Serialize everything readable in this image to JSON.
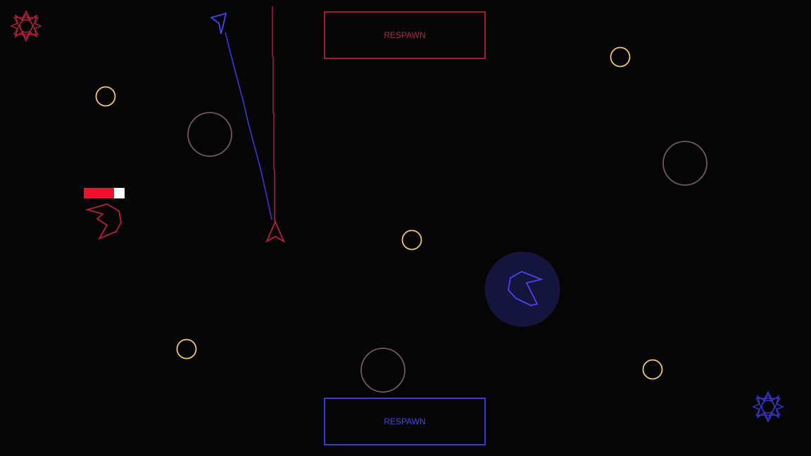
{
  "colors": {
    "background": "#050505",
    "red_team": "#a01e3c",
    "blue_team": "#3c36d2",
    "coin": "#f0c878",
    "asteroid": "#6e5a5a",
    "shield": "#14143c",
    "health_fill": "#f0102c",
    "health_empty": "#ffffff"
  },
  "red_player": {
    "respawn_label": "RESPAWN",
    "health_fraction": 0.74
  },
  "blue_player": {
    "respawn_label": "RESPAWN",
    "shield_active": true
  },
  "icons": {
    "red_base": "star-burst-icon",
    "blue_base": "star-burst-icon",
    "ship": "arrowhead-ship-icon",
    "coin": "ring-icon"
  }
}
